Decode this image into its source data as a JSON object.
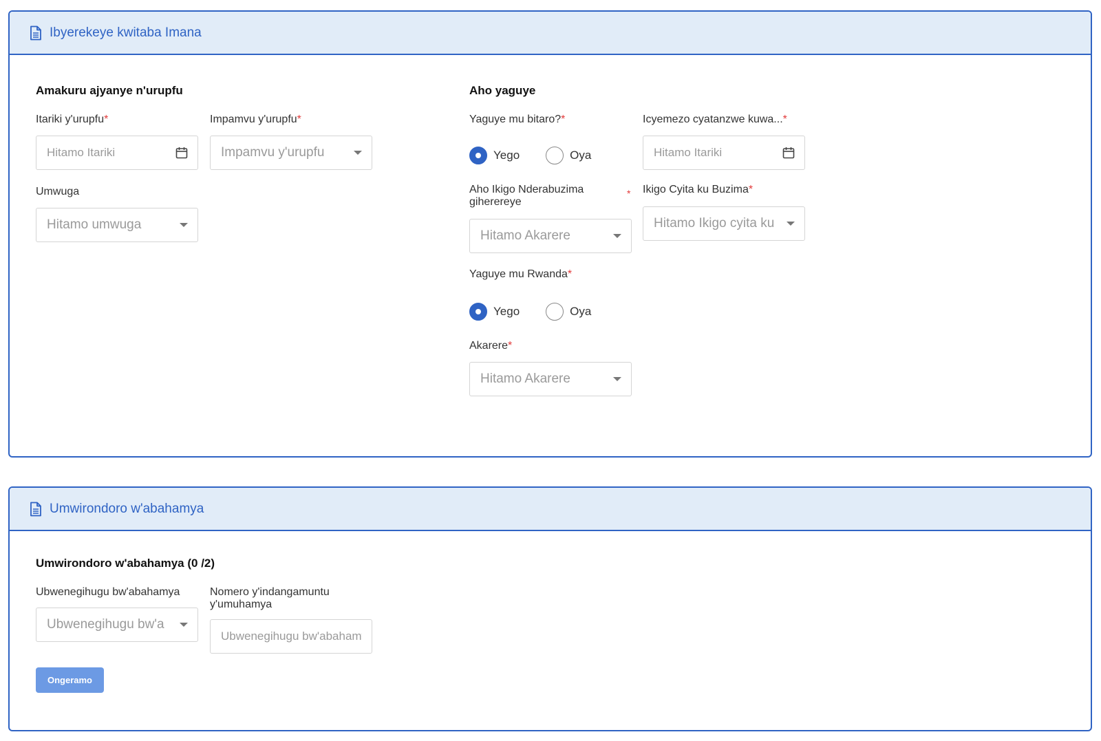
{
  "section1": {
    "header_title": "Ibyerekeye kwitaba Imana",
    "left_title": "Amakuru ajyanye n'urupfu",
    "date_label": "Itariki y'urupfu",
    "date_placeholder": "Hitamo Itariki",
    "cause_label": "Impamvu y'urupfu",
    "cause_placeholder": "Impamvu y'urupfu",
    "profession_label": "Umwuga",
    "profession_placeholder": "Hitamo umwuga",
    "right_title": "Aho yaguye",
    "hospital_label": "Yaguye mu bitaro?",
    "hospital_options": [
      "Yego",
      "Oya"
    ],
    "hospital_selected": "Yego",
    "decision_label": "Icyemezo cyatanzwe kuwa...",
    "decision_placeholder": "Hitamo Itariki",
    "health_center_label": "Aho Ikigo Nderabuzima giherereye",
    "health_center_placeholder": "Hitamo Akarere",
    "facility_label": "Ikigo Cyita ku Buzima",
    "facility_placeholder": "Hitamo Ikigo cyita ku",
    "rwanda_label": "Yaguye mu Rwanda",
    "rwanda_options": [
      "Yego",
      "Oya"
    ],
    "rwanda_selected": "Yego",
    "district_label": "Akarere",
    "district_placeholder": "Hitamo Akarere",
    "required_mark": "*"
  },
  "section2": {
    "header_title": "Umwirondoro w'abahamya",
    "subtitle": "Umwirondoro w'abahamya (0 /2)",
    "nationality_label": "Ubwenegihugu bw'abahamya",
    "nationality_placeholder": "Ubwenegihugu bw'a",
    "id_label": "Nomero y'indangamuntu y'umuhamya",
    "id_placeholder": "Ubwenegihugu bw'abahamya",
    "add_button": "Ongeramo"
  },
  "icons": {
    "header": "document-icon",
    "date": "calendar-icon",
    "select": "chevron-down-icon"
  },
  "colors": {
    "accent": "#2f63c4",
    "header_bg": "#e1ecf8",
    "required": "#e23a3a",
    "button": "#6c9ae4"
  }
}
